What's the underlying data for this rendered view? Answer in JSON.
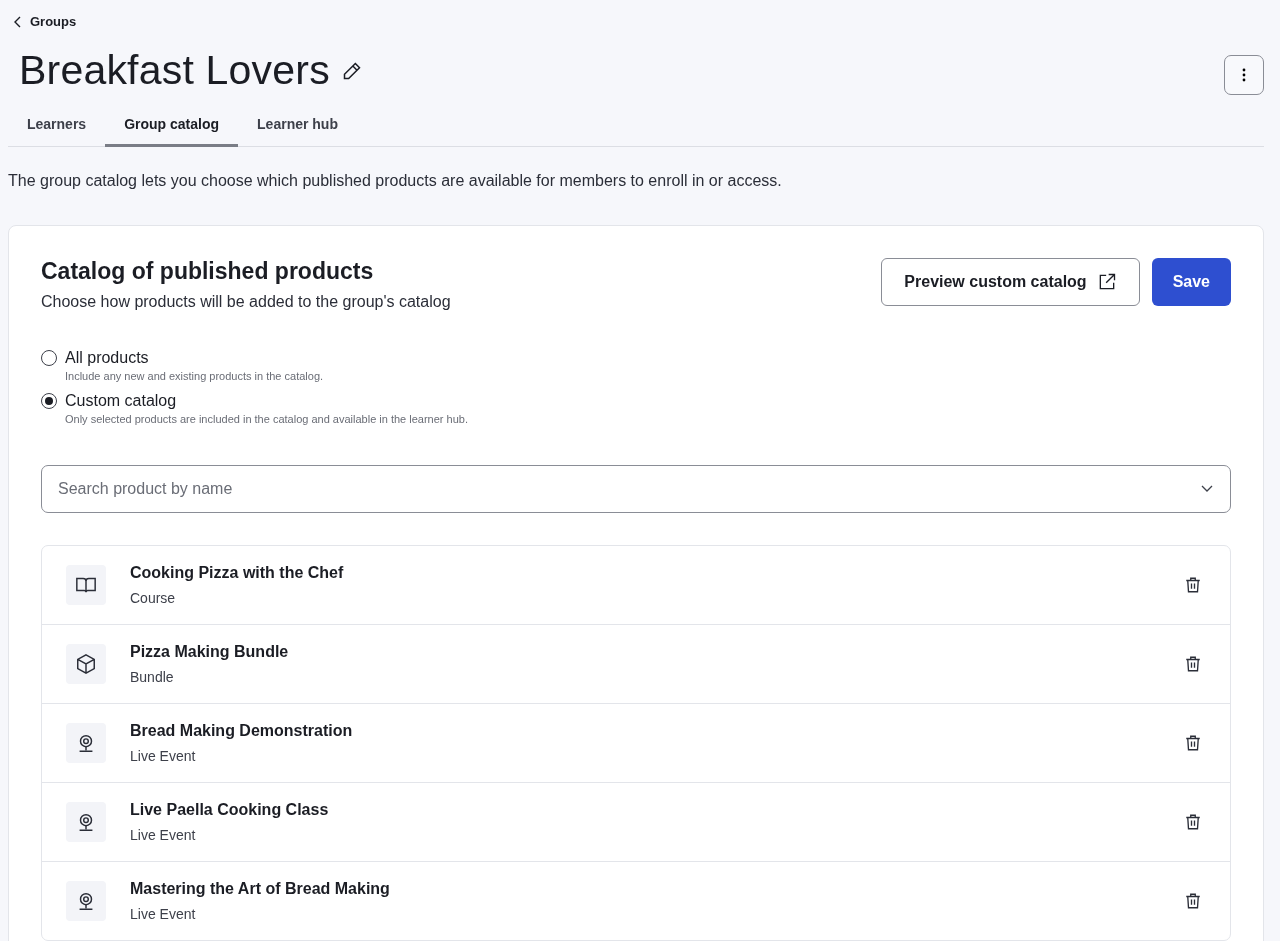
{
  "breadcrumb": {
    "label": "Groups"
  },
  "title": "Breakfast Lovers",
  "tabs": [
    {
      "label": "Learners",
      "selected": false
    },
    {
      "label": "Group catalog",
      "selected": true
    },
    {
      "label": "Learner hub",
      "selected": false
    }
  ],
  "description": "The group catalog lets you choose which published products are available for members to enroll in or access.",
  "catalog": {
    "heading": "Catalog of published products",
    "subheading": "Choose how products will be added to the group's catalog",
    "preview_button": "Preview custom catalog",
    "save_button": "Save",
    "options": [
      {
        "label": "All products",
        "hint": "Include any new and existing products in the catalog.",
        "selected": false
      },
      {
        "label": "Custom catalog",
        "hint": "Only selected products are included in the catalog and available in the learner hub.",
        "selected": true
      }
    ],
    "search": {
      "placeholder": "Search product by name"
    },
    "products": [
      {
        "name": "Cooking Pizza with the Chef",
        "type": "Course",
        "kind": "course"
      },
      {
        "name": "Pizza Making Bundle",
        "type": "Bundle",
        "kind": "bundle"
      },
      {
        "name": "Bread Making Demonstration",
        "type": "Live Event",
        "kind": "live"
      },
      {
        "name": "Live Paella Cooking Class",
        "type": "Live Event",
        "kind": "live"
      },
      {
        "name": "Mastering the Art of Bread Making",
        "type": "Live Event",
        "kind": "live"
      }
    ]
  }
}
